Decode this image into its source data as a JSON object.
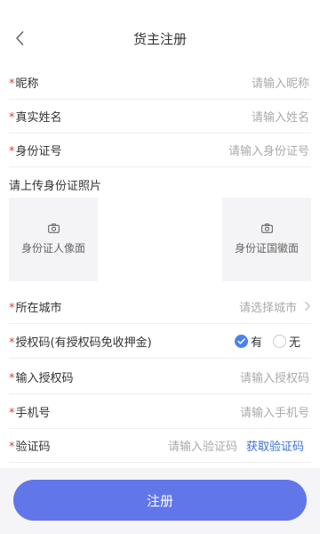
{
  "header": {
    "title": "货主注册",
    "back_icon": "chevron-left-icon"
  },
  "required_mark": "*",
  "fields": {
    "nickname": {
      "label": "昵称",
      "placeholder": "请输入昵称"
    },
    "real_name": {
      "label": "真实姓名",
      "placeholder": "请输入姓名"
    },
    "id_number": {
      "label": "身份证号",
      "placeholder": "请输入身份证号"
    },
    "city": {
      "label": "所在城市",
      "placeholder": "请选择城市"
    },
    "auth_option": {
      "label": "授权码(有授权码免收押金)",
      "options": [
        "有",
        "无"
      ],
      "selected": "有"
    },
    "auth_code": {
      "label": "输入授权码",
      "placeholder": "请输入授权码"
    },
    "phone": {
      "label": "手机号",
      "placeholder": "请输入手机号"
    },
    "verify_code": {
      "label": "验证码",
      "placeholder": "请输入验证码",
      "action": "获取验证码"
    }
  },
  "upload": {
    "title": "请上传身份证照片",
    "front_label": "身份证人像面",
    "back_label": "身份证国徽面"
  },
  "submit_label": "注册",
  "colors": {
    "accent": "#6176e8",
    "required": "#e23a3a",
    "link": "#3a6fd8",
    "radio_checked": "#4a82f0"
  }
}
